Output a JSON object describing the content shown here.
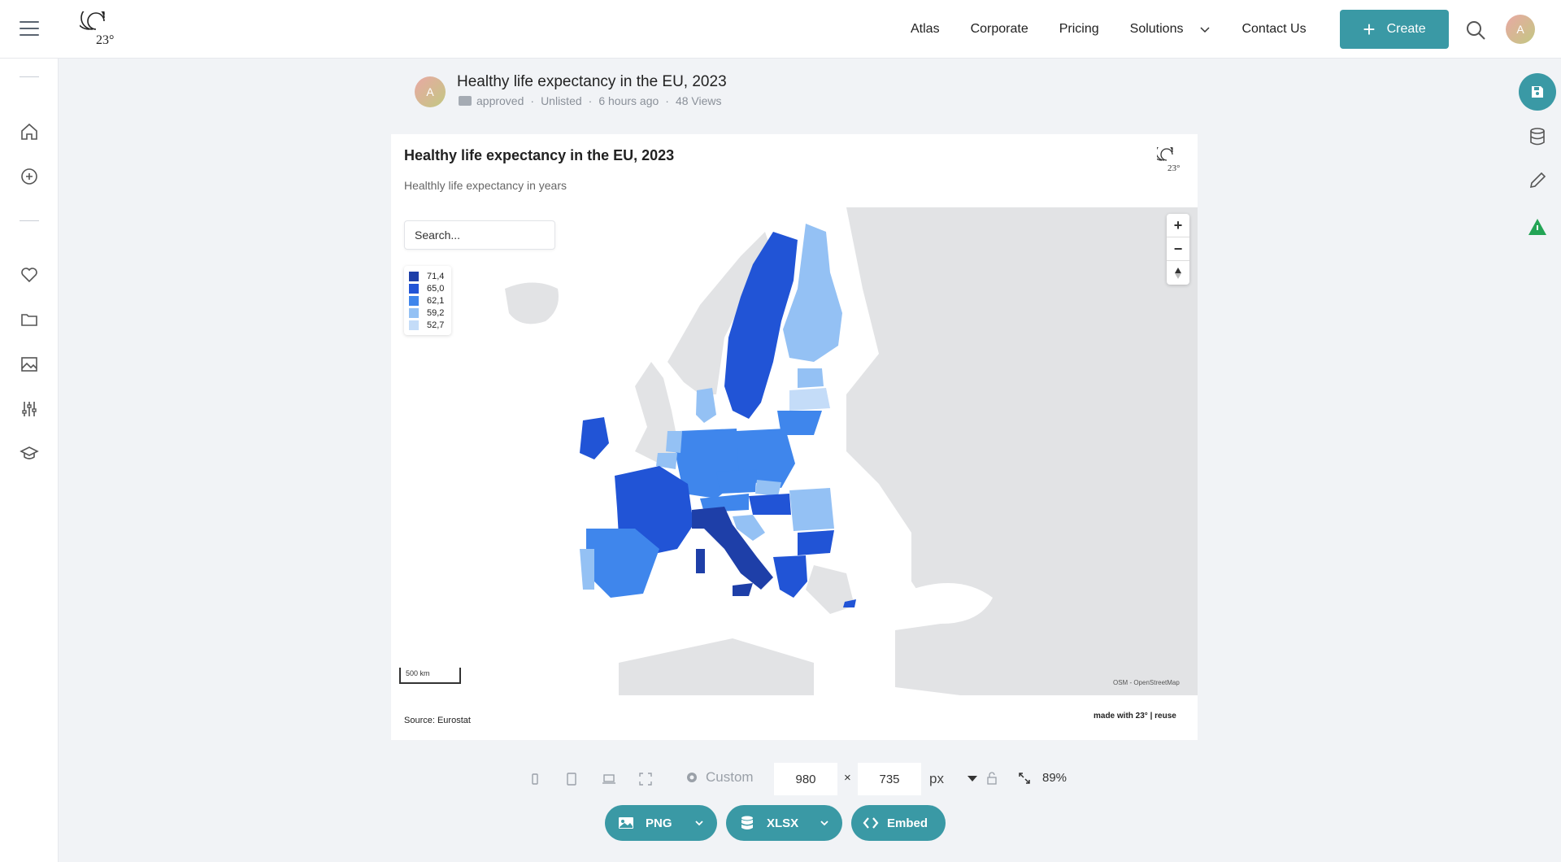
{
  "nav": {
    "items": [
      "Atlas",
      "Corporate",
      "Pricing",
      "Solutions",
      "Contact Us"
    ],
    "create_label": "Create",
    "avatar_initial": "A",
    "logo_text": "23°"
  },
  "document": {
    "title": "Healthy life expectancy in the EU, 2023",
    "folder": "approved",
    "visibility": "Unlisted",
    "updated": "6 hours ago",
    "views": "48 Views",
    "avatar_initial": "A"
  },
  "chart": {
    "title": "Healthy life expectancy in the EU, 2023",
    "subtitle": "Healthly life expectancy in years",
    "search_placeholder": "Search...",
    "legend": [
      {
        "label": "71,4",
        "color": "#1e3fa8"
      },
      {
        "label": "65,0",
        "color": "#2154d6"
      },
      {
        "label": "62,1",
        "color": "#3f86ec"
      },
      {
        "label": "59,2",
        "color": "#94c1f4"
      },
      {
        "label": "52,7",
        "color": "#c4dcf8"
      }
    ],
    "zoom_in": "+",
    "zoom_out": "−",
    "scale_label": "500 km",
    "attribution": "OSM - OpenStreetMap",
    "source": "Source: Eurostat",
    "made_with": "made with 23° | reuse"
  },
  "controls": {
    "preset_label": "Custom",
    "width": "980",
    "height": "735",
    "times": "×",
    "unit": "px",
    "zoom_pct": "89%"
  },
  "export": {
    "png": "PNG",
    "xlsx": "XLSX",
    "embed": "Embed"
  },
  "colors": {
    "accent": "#3a99a5",
    "land_other": "#e2e3e5"
  }
}
